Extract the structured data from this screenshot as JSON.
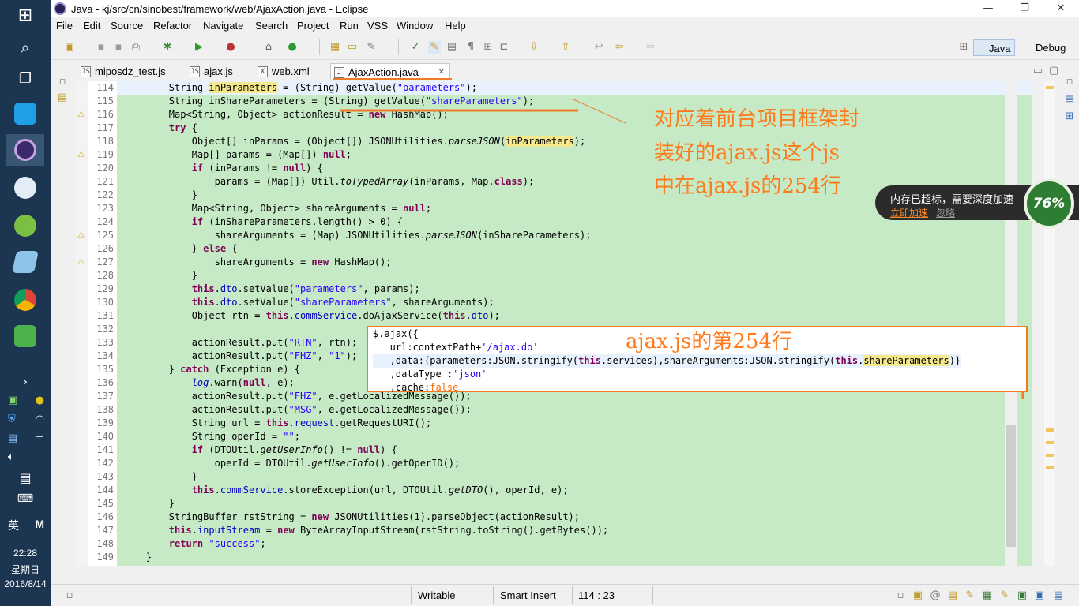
{
  "taskbar": {
    "time": "22:28",
    "weekday": "星期日",
    "date": "2016/8/14",
    "ime_lang": "英",
    "ime_mode": "M"
  },
  "window": {
    "title": "Java - kj/src/cn/sinobest/framework/web/AjaxAction.java - Eclipse"
  },
  "menu": [
    "File",
    "Edit",
    "Source",
    "Refactor",
    "Navigate",
    "Search",
    "Project",
    "Run",
    "VSS",
    "Window",
    "Help"
  ],
  "perspectives": [
    "Java",
    "Debug"
  ],
  "tabs": [
    "miposdz_test.js",
    "ajax.js",
    "web.xml",
    "AjaxAction.java"
  ],
  "editor": {
    "line_numbers": [
      "114",
      "115",
      "116",
      "117",
      "118",
      "119",
      "120",
      "121",
      "122",
      "123",
      "124",
      "125",
      "126",
      "127",
      "128",
      "129",
      "130",
      "131",
      "132",
      "133",
      "134",
      "135",
      "136",
      "137",
      "138",
      "139",
      "140",
      "141",
      "142",
      "143",
      "144",
      "145",
      "146",
      "147",
      "148",
      "149"
    ],
    "code": {
      "l114a": "        String ",
      "l114b": "inParameters",
      "l114c": " = (String) getValue(",
      "l114d": "\"parameters\"",
      "l114e": ");",
      "l115a": "        String inShareParameters = (String) getValue(",
      "l115b": "\"shareParameters\"",
      "l115c": ");",
      "l116a": "        Map<String, Object> actionResult = ",
      "l116b": "new",
      "l116c": " HashMap();",
      "l117a": "        ",
      "l117b": "try",
      "l117c": " {",
      "l118a": "            Object[] inParams = (Object[]) JSONUtilities.",
      "l118b": "parseJSON",
      "l118c": "(",
      "l118d": "inParameters",
      "l118e": ");",
      "l119a": "            Map[] params = (Map[]) ",
      "l119b": "null",
      "l119c": ";",
      "l120a": "            ",
      "l120b": "if",
      "l120c": " (inParams != ",
      "l120d": "null",
      "l120e": ") {",
      "l121a": "                params = (Map[]) Util.",
      "l121b": "toTypedArray",
      "l121c": "(inParams, Map.",
      "l121d": "class",
      "l121e": ");",
      "l122": "            }",
      "l123a": "            Map<String, Object> shareArguments = ",
      "l123b": "null",
      "l123c": ";",
      "l124a": "            ",
      "l124b": "if",
      "l124c": " (inShareParameters.length() > 0) {",
      "l125a": "                shareArguments = (Map) JSONUtilities.",
      "l125b": "parseJSON",
      "l125c": "(inShareParameters);",
      "l126a": "            } ",
      "l126b": "else",
      "l126c": " {",
      "l127a": "                shareArguments = ",
      "l127b": "new",
      "l127c": " HashMap();",
      "l128": "            }",
      "l129a": "            ",
      "l129b": "this",
      "l129c": ".",
      "l129d": "dto",
      "l129e": ".setValue(",
      "l129f": "\"parameters\"",
      "l129g": ", params);",
      "l130a": "            ",
      "l130b": "this",
      "l130c": ".",
      "l130d": "dto",
      "l130e": ".setValue(",
      "l130f": "\"shareParameters\"",
      "l130g": ", shareArguments);",
      "l131a": "            Object rtn = ",
      "l131b": "this",
      "l131c": ".",
      "l131d": "commService",
      "l131e": ".doAjaxService(",
      "l131f": "this",
      "l131g": ".",
      "l131h": "dto",
      "l131i": ");",
      "l132": "",
      "l133a": "            actionResult.put(",
      "l133b": "\"RTN\"",
      "l133c": ", rtn);",
      "l134a": "            actionResult.put(",
      "l134b": "\"FHZ\"",
      "l134c": ", ",
      "l134d": "\"1\"",
      "l134e": ");",
      "l135a": "        } ",
      "l135b": "catch",
      "l135c": " (Exception e) {",
      "l136a": "            ",
      "l136b": "log",
      "l136c": ".warn(",
      "l136d": "null",
      "l136e": ", e);",
      "l137a": "            actionResult.put(",
      "l137b": "\"FHZ\"",
      "l137c": ", e.getLocalizedMessage());",
      "l138a": "            actionResult.put(",
      "l138b": "\"MSG\"",
      "l138c": ", e.getLocalizedMessage());",
      "l139a": "            String url = ",
      "l139b": "this",
      "l139c": ".",
      "l139d": "request",
      "l139e": ".getRequestURI();",
      "l140a": "            String operId = ",
      "l140b": "\"\"",
      "l140c": ";",
      "l141a": "            ",
      "l141b": "if",
      "l141c": " (DTOUtil.",
      "l141d": "getUserInfo",
      "l141e": "() != ",
      "l141f": "null",
      "l141g": ") {",
      "l142a": "                operId = DTOUtil.",
      "l142b": "getUserInfo",
      "l142c": "().getOperID();",
      "l143": "            }",
      "l144a": "            ",
      "l144b": "this",
      "l144c": ".",
      "l144d": "commService",
      "l144e": ".storeException(url, DTOUtil.",
      "l144f": "getDTO",
      "l144g": "(), operId, e);",
      "l145": "        }",
      "l146a": "        StringBuffer rstString = ",
      "l146b": "new",
      "l146c": " JSONUtilities(1).parseObject(actionResult);",
      "l147a": "        ",
      "l147b": "this",
      "l147c": ".",
      "l147d": "inputStream",
      "l147e": " = ",
      "l147f": "new",
      "l147g": " ByteArrayInputStream(rstString.toString().getBytes());",
      "l148a": "        ",
      "l148b": "return",
      "l148c": " ",
      "l148d": "\"success\"",
      "l148e": ";",
      "l149": "    }"
    }
  },
  "annotations": {
    "note1_line1": "对应着前台项目框架封",
    "note1_line2": "装好的ajax.js这个js",
    "note1_line3": "中在ajax.js的254行",
    "note2": "ajax.js的第254行",
    "snippet": {
      "s1": "$.ajax({",
      "s2a": "   url:contextPath+",
      "s2b": "'/ajax.do'",
      "s3a": "   ,data:{parameters:JSON.stringify(",
      "s3b": "this",
      "s3c": ".services),shareArguments:JSON.stringify(",
      "s3d": "this",
      "s3e": ".",
      "s3f": "shareParameters",
      "s3g": ")}",
      "s4a": "   ,dataType :",
      "s4b": "'json'",
      "s5a": "   ,cache:",
      "s5b": "false"
    }
  },
  "status": {
    "writable": "Writable",
    "insert_mode": "Smart Insert",
    "position": "114 : 23"
  },
  "memory_popup": {
    "title": "内存已超标，需要深度加速",
    "accelerate": "立即加速",
    "ignore": "忽略",
    "percent": "76%"
  }
}
